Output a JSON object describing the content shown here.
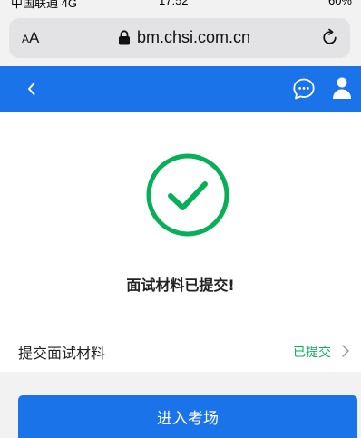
{
  "status_bar": {
    "carrier": "中国联通 4G",
    "time": "17:52",
    "battery": "60%"
  },
  "browser": {
    "text_size_label_small": "A",
    "text_size_label_large": "A",
    "url": "bm.chsi.com.cn",
    "lock_icon": "lock-icon",
    "reload_icon": "reload-icon"
  },
  "navbar": {
    "bg_color": "#1a73e8",
    "back_icon": "chevron-left-icon",
    "chat_icon": "chat-bubble-icon",
    "user_icon": "user-icon"
  },
  "result": {
    "icon": "check-circle-icon",
    "icon_color": "#07b058",
    "title": "面试材料已提交!"
  },
  "material_row": {
    "label": "提交面试材料",
    "status": "已提交",
    "status_color": "#07b058",
    "chevron_icon": "chevron-right-icon"
  },
  "enter_button": {
    "label": "进入考场"
  }
}
